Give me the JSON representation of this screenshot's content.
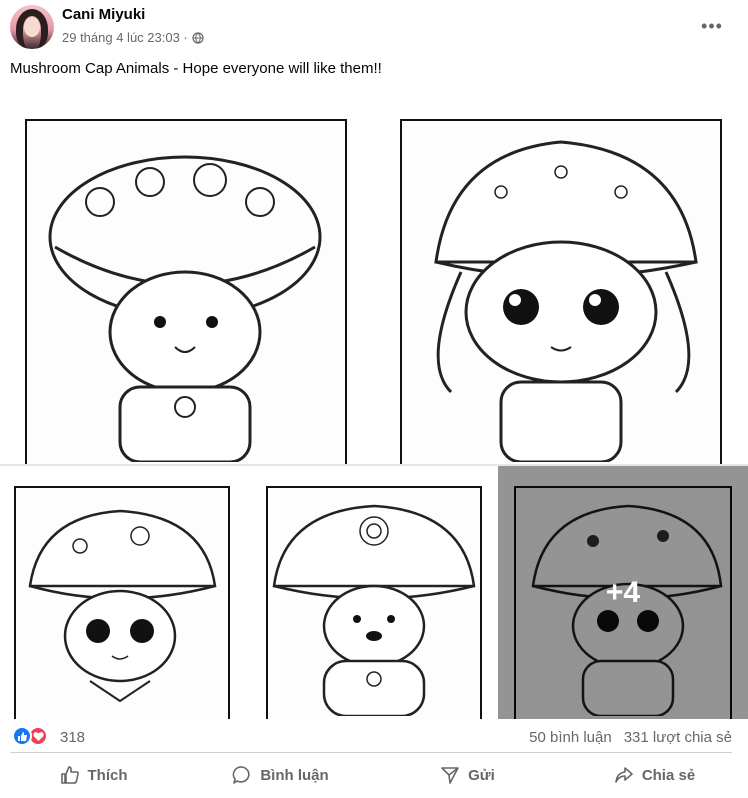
{
  "post": {
    "author": "Cani Miyuki",
    "timestamp": "29 tháng 4 lúc 23:03 ·",
    "privacy_icon": "globe-icon",
    "caption": "Mushroom Cap Animals - Hope everyone will like them!!",
    "more_icon": "more-dots-icon"
  },
  "images": {
    "items": [
      {
        "subject": "hamster-mushroom-cap-coloring-page"
      },
      {
        "subject": "bunny-mushroom-cap-coloring-page"
      },
      {
        "subject": "lamb-mushroom-cap-coloring-page"
      },
      {
        "subject": "bear-mushroom-cap-coloring-page"
      },
      {
        "subject": "cat-mushroom-cap-coloring-page"
      }
    ],
    "more_count": "+4"
  },
  "reactions": {
    "count": "318",
    "comments": "50 bình luận",
    "shares": "331 lượt chia sẻ",
    "like_color": "#1877f2",
    "love_color": "#f33e58"
  },
  "actions": {
    "like": "Thích",
    "comment": "Bình luận",
    "send": "Gửi",
    "share": "Chia sẻ"
  }
}
